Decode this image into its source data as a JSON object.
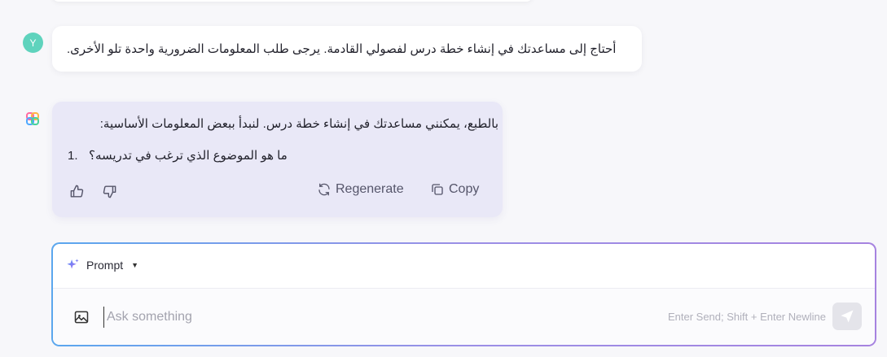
{
  "user": {
    "avatar_initial": "Y",
    "avatar_color": "#5fd3bd",
    "message": "أحتاج إلى مساعدتك في إنشاء خطة درس لفصولي القادمة. يرجى طلب المعلومات الضرورية واحدة تلو الأخرى."
  },
  "assistant": {
    "logo_icon": "colorful-knot-logo-icon",
    "line1": "بالطبع، يمكنني مساعدتك في إنشاء خطة درس. لنبدأ ببعض المعلومات الأساسية:",
    "list_number": "1.",
    "list_question": "ما هو الموضوع الذي ترغب في تدريسه؟",
    "bubble_color": "#e9e8f7",
    "actions": {
      "like_icon": "thumbs-up-icon",
      "dislike_icon": "thumbs-down-icon",
      "regenerate_label": "Regenerate",
      "regenerate_icon": "refresh-icon",
      "copy_label": "Copy",
      "copy_icon": "copy-icon"
    }
  },
  "composer": {
    "mode_label": "Prompt",
    "mode_icon": "sparkle-icon",
    "image_icon": "image-icon",
    "placeholder": "Ask something",
    "value": "",
    "hint": "Enter Send; Shift + Enter Newline",
    "send_icon": "paper-plane-icon",
    "border_gradient": [
      "#5ba7ee",
      "#a683e0"
    ]
  }
}
